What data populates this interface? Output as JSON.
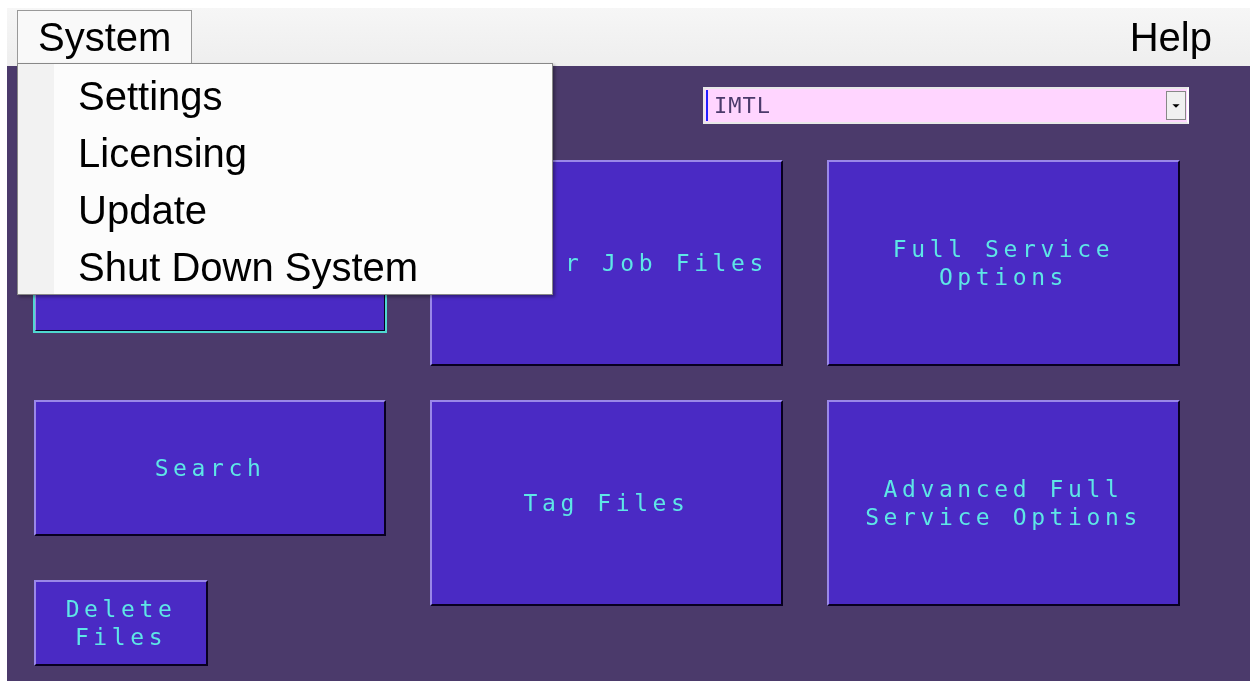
{
  "menu_bar": {
    "items": [
      {
        "label": "System",
        "selected": true
      },
      {
        "label": "Help",
        "selected": false
      }
    ]
  },
  "open_menu": {
    "items": [
      "Settings",
      "Licensing",
      "Update",
      "Shut Down System"
    ]
  },
  "site_select": {
    "value": "IMTL"
  },
  "button_columns": [
    [
      {
        "kind": "medium",
        "focused": true
      },
      {
        "kind": "short",
        "label": "Search",
        "focused": false
      },
      {
        "kind": "small",
        "label": "Delete\nFiles",
        "focused": false
      }
    ],
    [
      {
        "kind": "tall",
        "label": "r Job Files",
        "focused": false,
        "covered": true
      },
      {
        "kind": "tall",
        "label": "Tag Files",
        "focused": false
      }
    ],
    [
      {
        "kind": "tall",
        "label": "Full Service\nOptions",
        "focused": false
      },
      {
        "kind": "tall",
        "label": "Advanced Full\nService Options",
        "focused": false
      }
    ]
  ]
}
